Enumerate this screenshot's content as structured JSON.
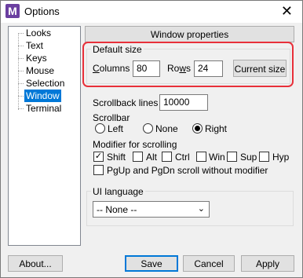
{
  "window": {
    "title": "Options",
    "icon_letter": "M",
    "close_glyph": "✕"
  },
  "tree": {
    "items": [
      {
        "label": "Looks"
      },
      {
        "label": "Text"
      },
      {
        "label": "Keys"
      },
      {
        "label": "Mouse"
      },
      {
        "label": "Selection"
      },
      {
        "label": "Window",
        "selected": true
      },
      {
        "label": "Terminal"
      }
    ]
  },
  "panel": {
    "header": "Window properties"
  },
  "default_size": {
    "label": "Default size",
    "columns_label": "Columns",
    "columns_value": "80",
    "rows_label": "Rows",
    "rows_value": "24",
    "current_size_button": "Current size"
  },
  "scrollback": {
    "label": "Scrollback lines",
    "value": "10000"
  },
  "scrollbar": {
    "label": "Scrollbar",
    "options": [
      {
        "label": "Left",
        "checked": false
      },
      {
        "label": "None",
        "checked": false
      },
      {
        "label": "Right",
        "checked": true
      }
    ]
  },
  "modifier": {
    "label": "Modifier for scrolling",
    "options": [
      {
        "label": "Shift",
        "checked": true
      },
      {
        "label": "Alt",
        "checked": false
      },
      {
        "label": "Ctrl",
        "checked": false
      },
      {
        "label": "Win",
        "checked": false
      },
      {
        "label": "Sup",
        "checked": false
      },
      {
        "label": "Hyp",
        "checked": false
      }
    ],
    "pgup_label": "PgUp and PgDn scroll without modifier",
    "pgup_checked": false
  },
  "ui_language": {
    "label": "UI language",
    "value": "-- None --"
  },
  "buttons": {
    "about": "About...",
    "save": "Save",
    "cancel": "Cancel",
    "apply": "Apply"
  },
  "colors": {
    "highlight": "#e8303a",
    "selection": "#0078d7"
  }
}
